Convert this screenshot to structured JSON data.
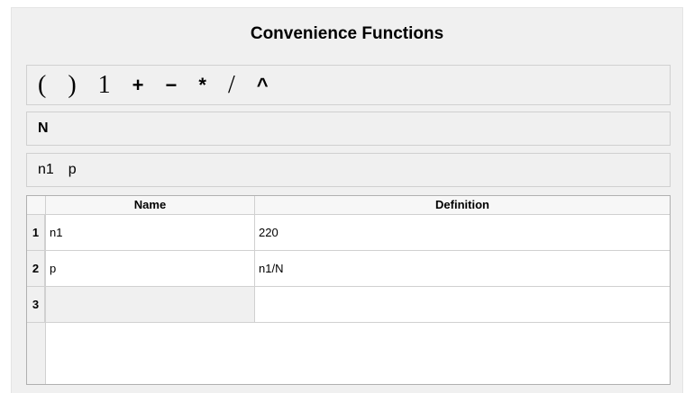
{
  "panel": {
    "title": "Convenience Functions"
  },
  "operators": [
    "(",
    ")",
    "1",
    "+",
    "−",
    "*",
    "/",
    "^"
  ],
  "variables": [
    "N"
  ],
  "functions": [
    "n1",
    "p"
  ],
  "table": {
    "columns": [
      "Name",
      "Definition"
    ],
    "rows": [
      {
        "num": "1",
        "name": "n1",
        "definition": "220"
      },
      {
        "num": "2",
        "name": "p",
        "definition": "n1/N"
      },
      {
        "num": "3",
        "name": "",
        "definition": ""
      }
    ]
  }
}
